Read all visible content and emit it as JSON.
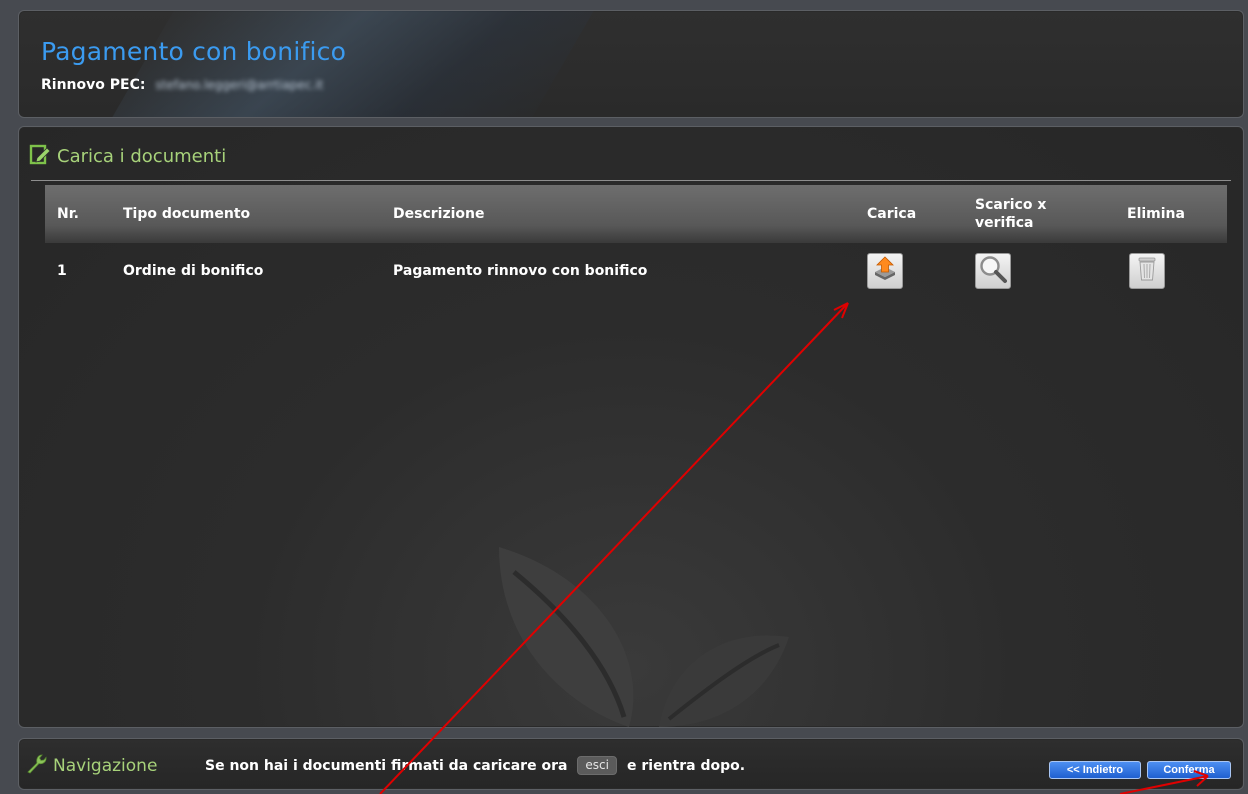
{
  "header": {
    "title": "Pagamento con bonifico",
    "subtitle_label": "Rinnovo PEC:",
    "pec_email": "stefano.leggeri@arrtiapec.it"
  },
  "section": {
    "heading": "Carica i documenti",
    "icon": "edit-document-icon"
  },
  "table": {
    "columns": [
      "Nr.",
      "Tipo documento",
      "Descrizione",
      "Carica",
      "Scarico x verifica",
      "Elimina"
    ],
    "rows": [
      {
        "nr": "1",
        "tipo": "Ordine di bonifico",
        "descrizione": "Pagamento rinnovo con bonifico",
        "carica_icon": "upload-icon",
        "scarico_icon": "magnifier-icon",
        "elimina_icon": "trash-icon"
      }
    ]
  },
  "navigation": {
    "heading": "Navigazione",
    "icon": "wrench-icon",
    "message_before": "Se non hai i documenti firmati da caricare ora",
    "exit_label": "esci",
    "message_after": "e rientra dopo.",
    "back_label": "<< Indietro",
    "confirm_label": "Conferma"
  },
  "colors": {
    "title_blue": "#3b9bf0",
    "heading_green": "#a7d27a",
    "button_blue": "#2f6fe0",
    "annotation_red": "#e00000"
  }
}
